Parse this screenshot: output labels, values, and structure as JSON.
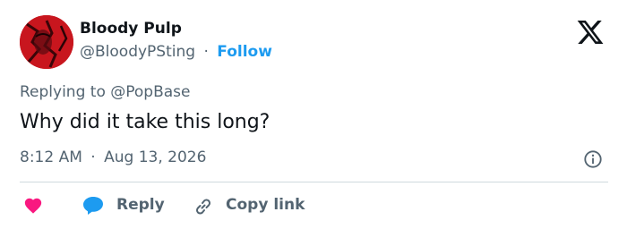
{
  "tweet": {
    "author": {
      "display_name": "Bloody Pulp",
      "handle": "@BloodyPSting",
      "follow_label": "Follow",
      "separator": "·"
    },
    "replying_to_prefix": "Replying to",
    "replying_to_handle": "@PopBase",
    "text": "Why did it take this long?",
    "time": "8:12 AM",
    "date": "Aug 13, 2026",
    "actions": {
      "reply_label": "Reply",
      "copy_link_label": "Copy link"
    }
  },
  "icons": {
    "brand": "x-logo-icon",
    "info": "info-icon",
    "like": "heart-icon",
    "reply": "speech-bubble-icon",
    "copy": "link-icon"
  },
  "colors": {
    "text_primary": "#0f1419",
    "text_secondary": "#536471",
    "accent": "#1d9bf0",
    "like": "#f91880",
    "avatar_bg": "#c8161e",
    "divider": "#cfd9de"
  }
}
